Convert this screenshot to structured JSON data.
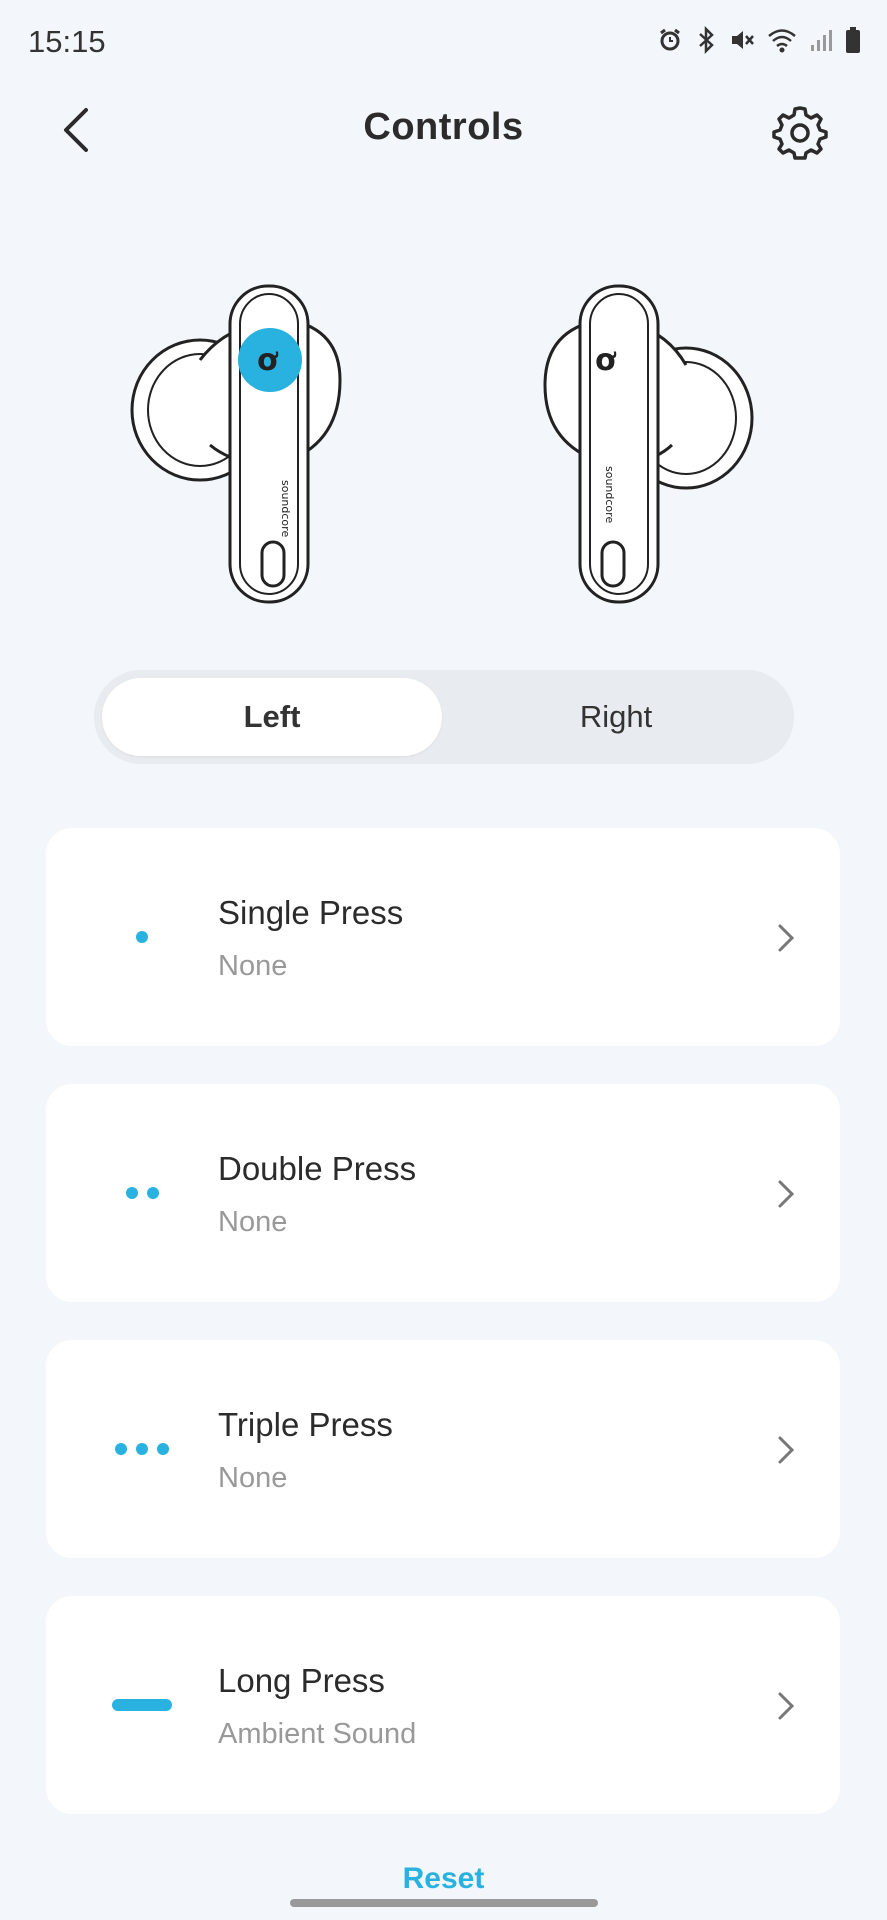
{
  "status_bar": {
    "time": "15:15",
    "icons": [
      "alarm-icon",
      "bluetooth-icon",
      "mute-icon",
      "wifi-icon",
      "signal-icon",
      "battery-icon"
    ]
  },
  "header": {
    "title": "Controls"
  },
  "earbud_tabs": [
    {
      "label": "Left",
      "selected": true
    },
    {
      "label": "Right",
      "selected": false
    }
  ],
  "controls": [
    {
      "title": "Single Press",
      "value": "None",
      "icon": "single-dot-icon"
    },
    {
      "title": "Double Press",
      "value": "None",
      "icon": "double-dot-icon"
    },
    {
      "title": "Triple Press",
      "value": "None",
      "icon": "triple-dot-icon"
    },
    {
      "title": "Long Press",
      "value": "Ambient Sound",
      "icon": "long-dash-icon"
    }
  ],
  "reset_label": "Reset",
  "colors": {
    "accent": "#29b2df",
    "background": "#f3f6fa",
    "card": "#ffffff"
  }
}
